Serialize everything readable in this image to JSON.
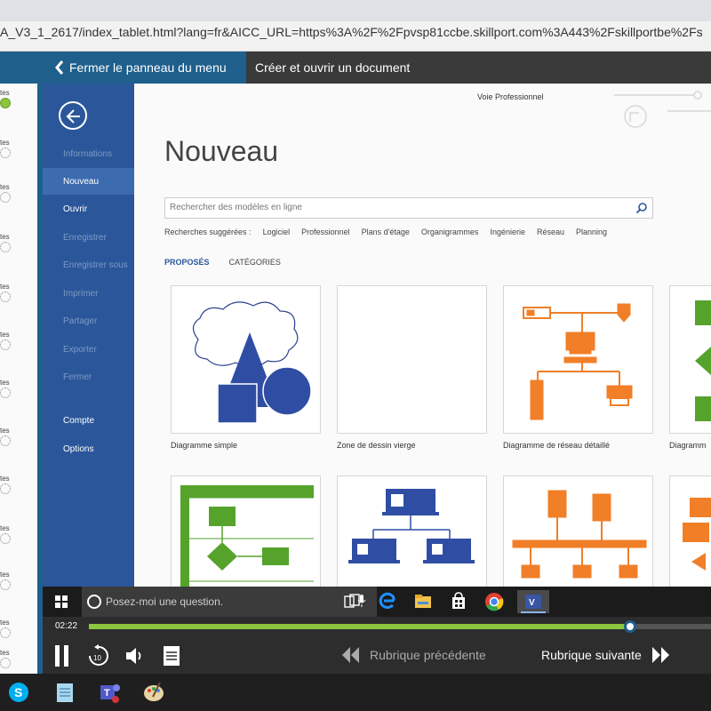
{
  "browser": {
    "url": "A_V3_1_2617/index_tablet.html?lang=fr&AICC_URL=https%3A%2F%2Fpvsp81ccbe.skillport.com%3A443%2Fskillportbe%2Fs"
  },
  "course_header": {
    "close_menu_label": "Fermer le panneau du menu",
    "document_title": "Créer et ouvrir un document"
  },
  "left_panel": {
    "rows": [
      {
        "label": "tes",
        "status": "done"
      },
      {
        "label": "tes",
        "status": "todo"
      },
      {
        "label": "tes",
        "status": "todo"
      },
      {
        "label": "tes",
        "status": "todo"
      },
      {
        "label": "tes",
        "status": "todo"
      },
      {
        "label": "tes",
        "status": "todo"
      },
      {
        "label": "tes",
        "status": "todo"
      },
      {
        "label": "tes",
        "status": "todo"
      },
      {
        "label": "tes",
        "status": "todo"
      },
      {
        "label": "tes",
        "status": "todo"
      },
      {
        "label": "tes",
        "status": "todo"
      },
      {
        "label": "tes",
        "status": "todo"
      },
      {
        "label": "tes",
        "status": "todo"
      }
    ]
  },
  "backstage": {
    "items": [
      {
        "label": "Informations",
        "state": "disabled"
      },
      {
        "label": "Nouveau",
        "state": "active"
      },
      {
        "label": "Ouvrir",
        "state": "enabled"
      },
      {
        "label": "Enregistrer",
        "state": "disabled"
      },
      {
        "label": "Enregistrer sous",
        "state": "disabled"
      },
      {
        "label": "Imprimer",
        "state": "disabled"
      },
      {
        "label": "Partager",
        "state": "disabled"
      },
      {
        "label": "Exporter",
        "state": "disabled"
      },
      {
        "label": "Fermer",
        "state": "disabled"
      },
      {
        "label": "Compte",
        "state": "enabled"
      },
      {
        "label": "Options",
        "state": "enabled"
      }
    ]
  },
  "content": {
    "user_name": "Voie Professionnel",
    "title": "Nouveau",
    "search_placeholder": "Rechercher des modèles en ligne",
    "suggestions_label": "Recherches suggérées :",
    "suggestions": [
      "Logiciel",
      "Professionnel",
      "Plans d'étage",
      "Organigrammes",
      "Ingénierie",
      "Réseau",
      "Planning"
    ],
    "tabs": [
      {
        "label": "PROPOSÉS",
        "active": true
      },
      {
        "label": "CATÉGORIES",
        "active": false
      }
    ],
    "templates": [
      {
        "caption": "Diagramme simple"
      },
      {
        "caption": "Zone de dessin vierge"
      },
      {
        "caption": "Diagramme de réseau détaillé"
      },
      {
        "caption": "Diagramm"
      },
      {
        "caption": ""
      },
      {
        "caption": ""
      },
      {
        "caption": ""
      },
      {
        "caption": ""
      }
    ]
  },
  "taskbar": {
    "cortana_placeholder": "Posez-moi une question."
  },
  "player": {
    "elapsed": "02:22",
    "progress_fraction": 0.87,
    "prev_label": "Rubrique précédente",
    "next_label": "Rubrique suivante"
  },
  "colors": {
    "accent_blue": "#1e5f8c",
    "word_blue": "#2b579a",
    "visio_orange": "#f07f28",
    "visio_green": "#56a32c",
    "progress_green": "#8cc63f"
  }
}
